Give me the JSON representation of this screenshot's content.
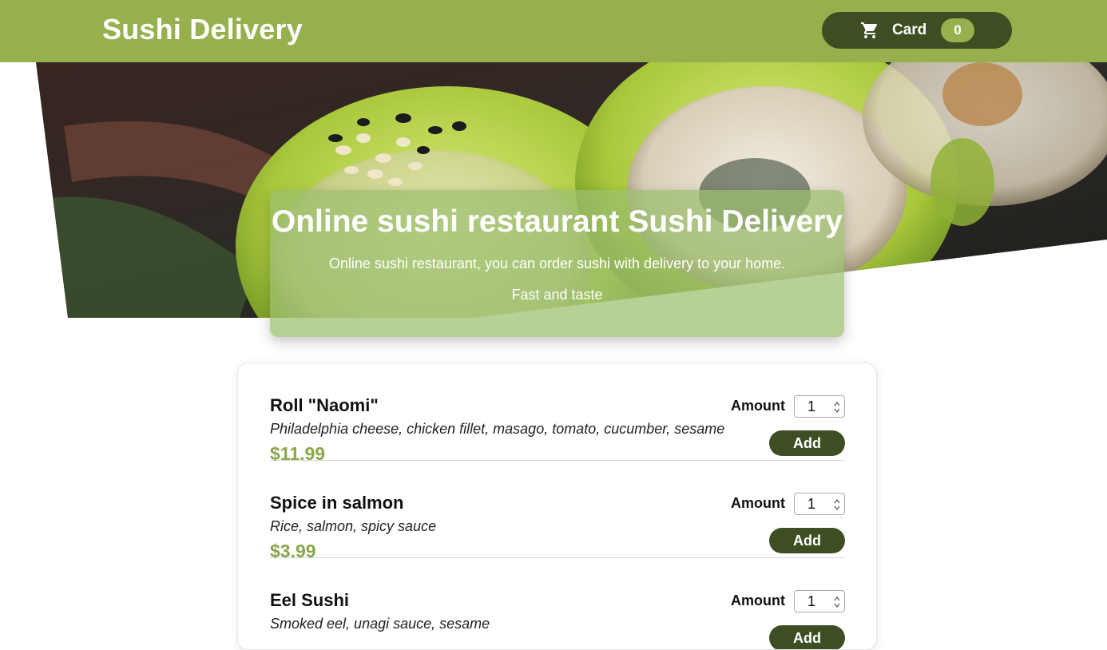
{
  "header": {
    "brand": "Sushi Delivery",
    "cart_label": "Card",
    "cart_count": "0",
    "cart_icon": "cart-icon"
  },
  "hero": {
    "title": "Online sushi restaurant Sushi Delivery",
    "subtitle": "Online sushi restaurant, you can order sushi with delivery to your home.",
    "tagline": "Fast and taste",
    "image": "sushi-roll-photo"
  },
  "menu": {
    "amount_label": "Amount",
    "add_label": "Add",
    "items": [
      {
        "title": "Roll \"Naomi\"",
        "description": "Philadelphia cheese, chicken fillet, masago, tomato, cucumber, sesame",
        "price": "$11.99",
        "amount": "1"
      },
      {
        "title": "Spice in salmon",
        "description": "Rice, salmon, spicy sauce",
        "price": "$3.99",
        "amount": "1"
      },
      {
        "title": "Eel Sushi",
        "description": "Smoked eel, unagi sauce, sesame",
        "price": "",
        "amount": "1"
      }
    ]
  },
  "colors": {
    "header_bg": "#95b04d",
    "dark_green": "#3d4f22",
    "price_green": "#8aa64b"
  }
}
